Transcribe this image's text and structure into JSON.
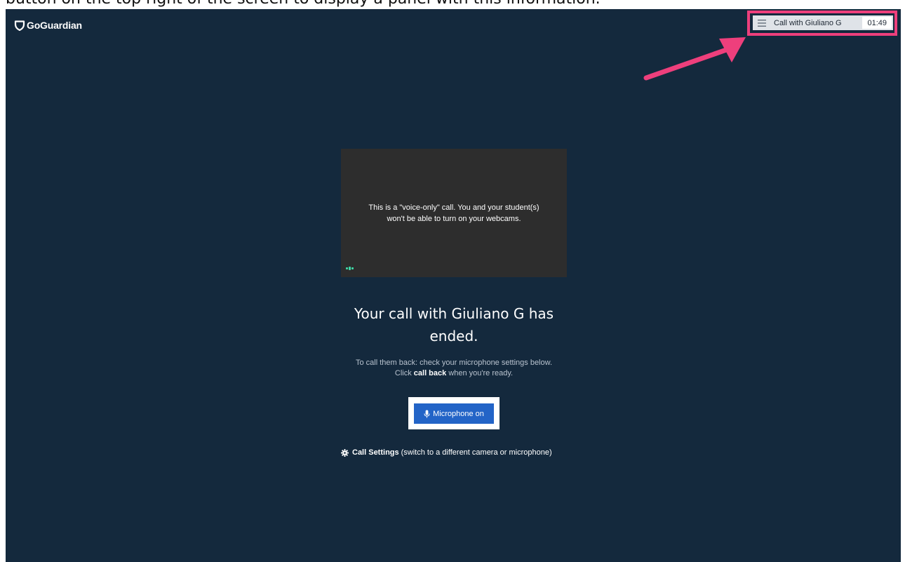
{
  "caption": {
    "text": "button on the top right of the screen to display a panel with this information."
  },
  "header": {
    "logo_text": "GoGuardian",
    "logo_icon": "shield-icon"
  },
  "call_pill": {
    "menu_icon": "hamburger-menu-icon",
    "label": "Call with Giuliano G",
    "timer": "01:49"
  },
  "annotation": {
    "arrow_color": "#ee3f7c",
    "highlight_color": "#ee3f7c"
  },
  "video": {
    "message_line1": "This is a \"voice-only\" call. You and your student(s)",
    "message_line2": "won't be able to turn on your webcams.",
    "audio_indicator_color": "#3fd9a7"
  },
  "ended": {
    "title_line1": "Your call with Giuliano G has",
    "title_line2": "ended.",
    "sub_line1": "To call them back: check your microphone settings below.",
    "sub_line2_prefix": "Click",
    "sub_line2_bold": "call back",
    "sub_line2_suffix": "when you're ready."
  },
  "microphone_button": {
    "label": "Microphone on",
    "icon": "microphone-icon",
    "color": "#2364c7"
  },
  "call_settings": {
    "icon": "gear-icon",
    "label_bold": "Call Settings",
    "label_rest": "(switch to a different camera or microphone)"
  },
  "colors": {
    "background": "#14293d",
    "video_bg": "#2d2d2d"
  }
}
